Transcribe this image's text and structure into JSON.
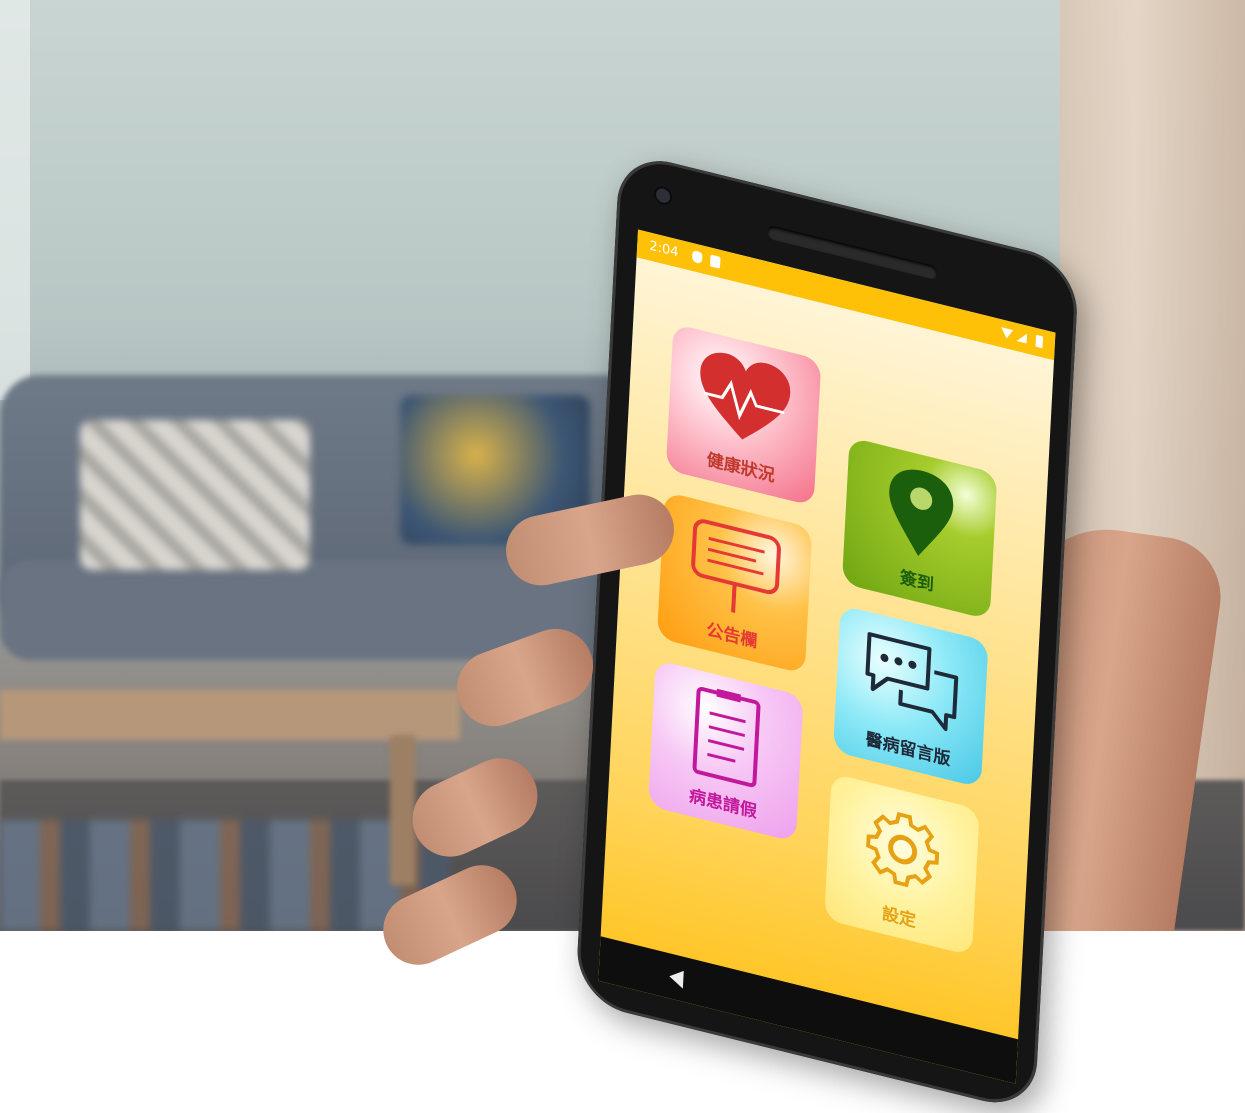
{
  "status_bar": {
    "time": "2:04"
  },
  "tiles": [
    {
      "id": "health",
      "label": "健康狀況",
      "icon": "heart-pulse-icon",
      "color": "#f46f88"
    },
    {
      "id": "checkin",
      "label": "簽到",
      "icon": "map-pin-icon",
      "color": "#6fa612"
    },
    {
      "id": "bulletin",
      "label": "公告欄",
      "icon": "signboard-icon",
      "color": "#ff9d10"
    },
    {
      "id": "message",
      "label": "醫病留言版",
      "icon": "chat-bubbles-icon",
      "color": "#49c8e5"
    },
    {
      "id": "leave",
      "label": "病患請假",
      "icon": "document-icon",
      "color": "#eea0ec"
    },
    {
      "id": "settings",
      "label": "設定",
      "icon": "gear-icon",
      "color": "#ffe67a"
    }
  ],
  "theme": {
    "status_bar_color": "#ffc107"
  }
}
